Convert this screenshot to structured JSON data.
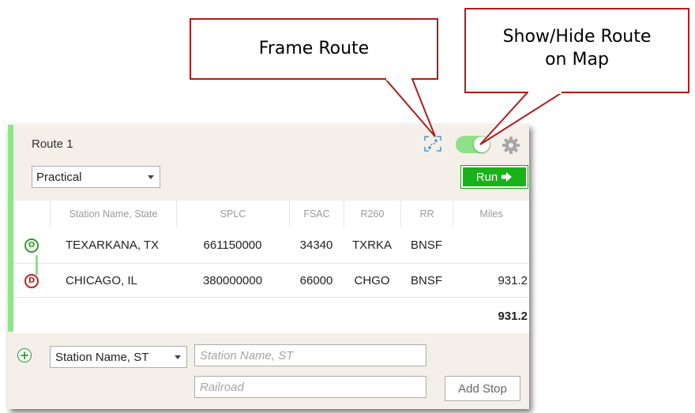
{
  "callouts": {
    "frame_route": "Frame Route",
    "show_hide_line1": "Show/Hide Route",
    "show_hide_line2": "on Map"
  },
  "route": {
    "title": "Route 1",
    "mode": "Practical",
    "run_label": "Run",
    "toggle_on": true
  },
  "table": {
    "headers": [
      "Station Name, State",
      "SPLC",
      "FSAC",
      "R260",
      "RR",
      "Miles"
    ],
    "rows": [
      {
        "badge": "O",
        "name": "TEXARKANA, TX",
        "splc": "661150000",
        "fsac": "34340",
        "r260": "TXRKA",
        "rr": "BNSF",
        "miles": ""
      },
      {
        "badge": "D",
        "name": "CHICAGO, IL",
        "splc": "380000000",
        "fsac": "66000",
        "r260": "CHGO",
        "rr": "BNSF",
        "miles": "931.2"
      }
    ],
    "total_miles": "931.2"
  },
  "add_stop": {
    "type_select": "Station Name, ST",
    "station_placeholder": "Station Name, ST",
    "railroad_placeholder": "Railroad",
    "button_label": "Add Stop"
  },
  "colors": {
    "accent_green": "#8fe48a",
    "run_green": "#19b219",
    "callout_border": "#b01c1c",
    "origin": "#2e9e2e",
    "destination": "#c41e1e"
  }
}
